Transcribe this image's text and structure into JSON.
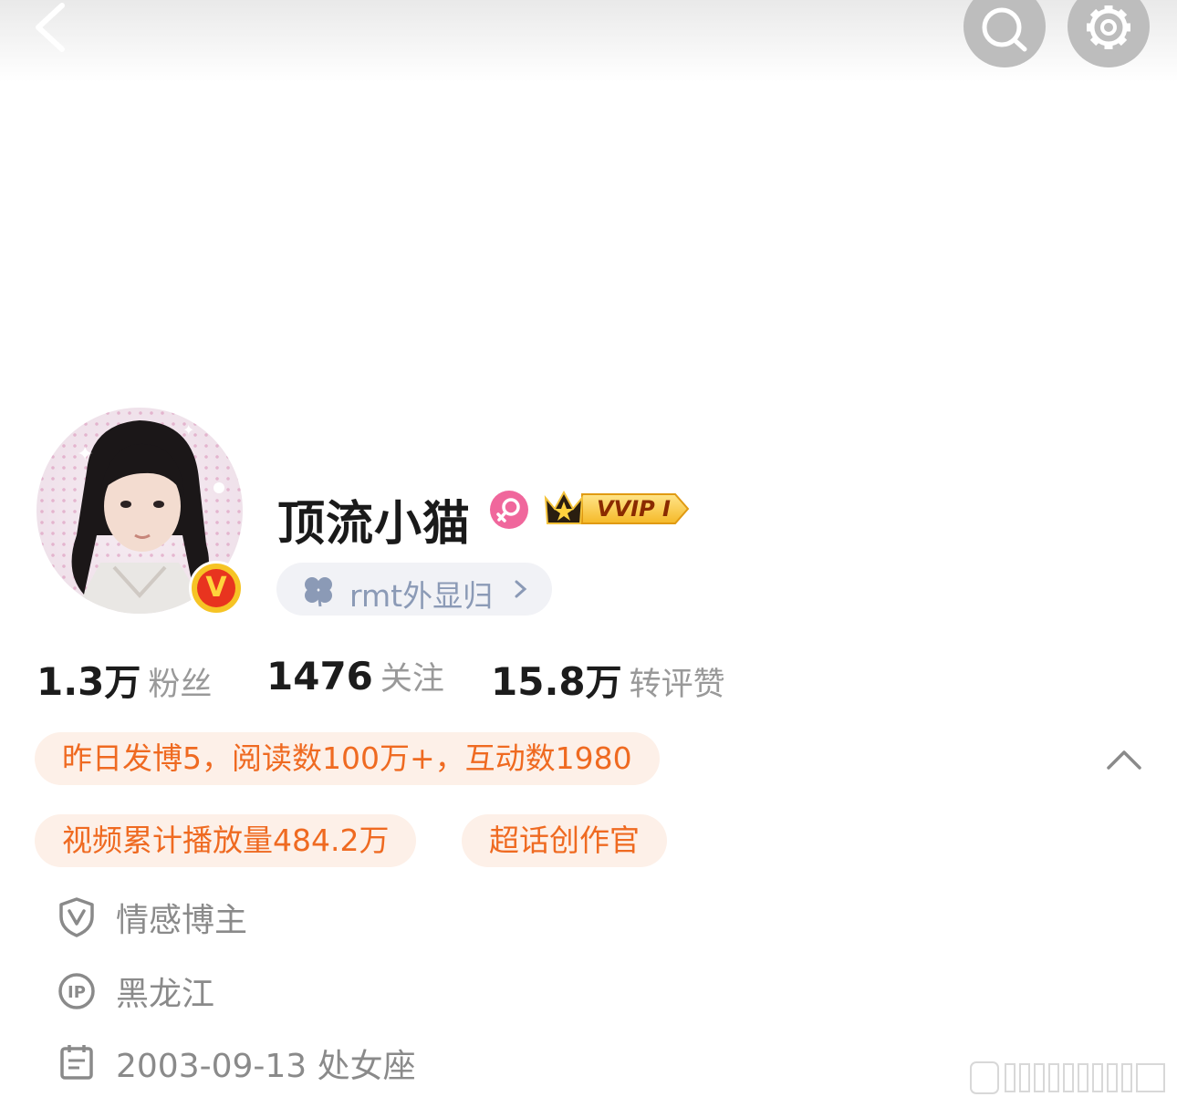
{
  "header": {
    "back_icon": "chevron-left-icon",
    "search_icon": "search-icon",
    "settings_icon": "gear-icon"
  },
  "profile": {
    "name": "顶流小猫",
    "gender_icon": "female-icon",
    "vip_badge": "VVIP I",
    "verified_icon": "verified-v-icon",
    "group_label": "rmt外显归",
    "group_icon": "clover-icon"
  },
  "stats": [
    {
      "value": "1.3",
      "unit": "万",
      "label": "粉丝"
    },
    {
      "value": "1476",
      "unit": "",
      "label": "关注"
    },
    {
      "value": "15.8",
      "unit": "万",
      "label": "转评赞"
    }
  ],
  "tags": {
    "activity": "昨日发博5，阅读数100万+，互动数1980",
    "video": "视频累计播放量484.2万",
    "supertopic": "超话创作官"
  },
  "info": {
    "category": "情感博主",
    "ip_location": "黑龙江",
    "birthday": "2003-09-13 处女座"
  },
  "colors": {
    "accent_orange": "#ef6a21",
    "tag_bg": "#fdf0e8",
    "pill_bg": "#f1f2f6",
    "muted_text": "#999999"
  }
}
